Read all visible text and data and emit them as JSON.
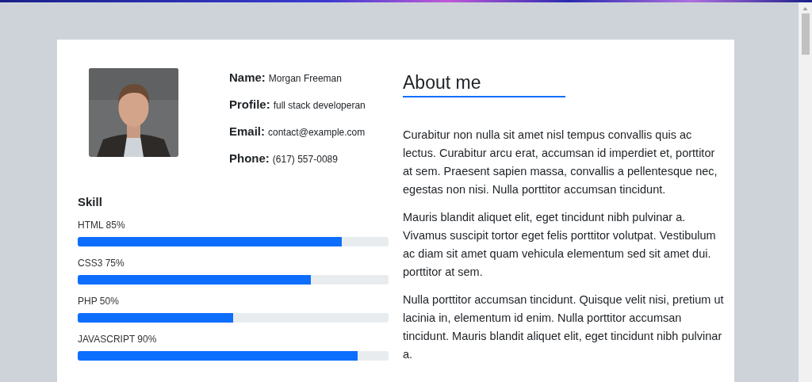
{
  "profile": {
    "fields": [
      {
        "label": "Name:",
        "value": "Morgan Freeman"
      },
      {
        "label": "Profile:",
        "value": "full stack developeran"
      },
      {
        "label": "Email:",
        "value": "contact@example.com"
      },
      {
        "label": "Phone:",
        "value": "(617) 557-0089"
      }
    ]
  },
  "skills": {
    "title": "Skill",
    "items": [
      {
        "label": "HTML 85%",
        "level": 0.85
      },
      {
        "label": "CSS3 75%",
        "level": 0.75
      },
      {
        "label": "PHP 50%",
        "level": 0.5
      },
      {
        "label": "JAVASCRIPT 90%",
        "level": 0.9
      }
    ]
  },
  "about": {
    "title": "About me",
    "paragraphs": [
      "Curabitur non nulla sit amet nisl tempus convallis quis ac lectus. Curabitur arcu erat, accumsan id imperdiet et, porttitor at sem. Praesent sapien massa, convallis a pellentesque nec, egestas non nisi. Nulla porttitor accumsan tincidunt.",
      "Mauris blandit aliquet elit, eget tincidunt nibh pulvinar a. Vivamus suscipit tortor eget felis porttitor volutpat. Vestibulum ac diam sit amet quam vehicula elementum sed sit amet dui. porttitor at sem.",
      "Nulla porttitor accumsan tincidunt. Quisque velit nisi, pretium ut lacinia in, elementum id enim. Nulla porttitor accumsan tincidunt. Mauris blandit aliquet elit, eget tincidunt nibh pulvinar a."
    ]
  }
}
